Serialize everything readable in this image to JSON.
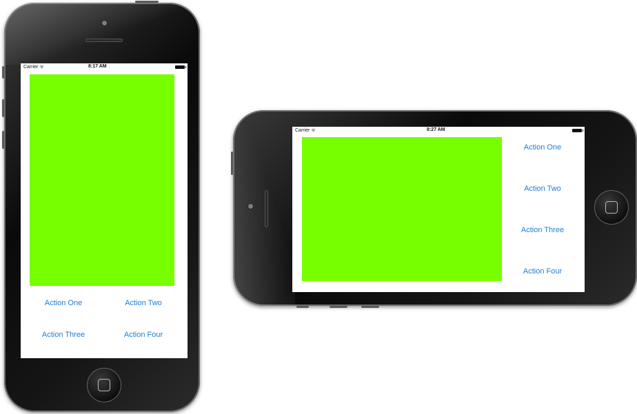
{
  "portrait": {
    "status": {
      "carrier": "Carrier ᯤ",
      "time": "8:17 AM"
    },
    "actions": [
      "Action One",
      "Action Two",
      "Action Three",
      "Action Four"
    ]
  },
  "landscape": {
    "status": {
      "carrier": "Carrier ᯤ",
      "time": "8:27 AM"
    },
    "actions": [
      "Action One",
      "Action Two",
      "Action Three",
      "Action Four"
    ]
  },
  "colors": {
    "green_view": "#77ff00",
    "action_text": "#1e7bd8",
    "phone_body": "#111111"
  }
}
